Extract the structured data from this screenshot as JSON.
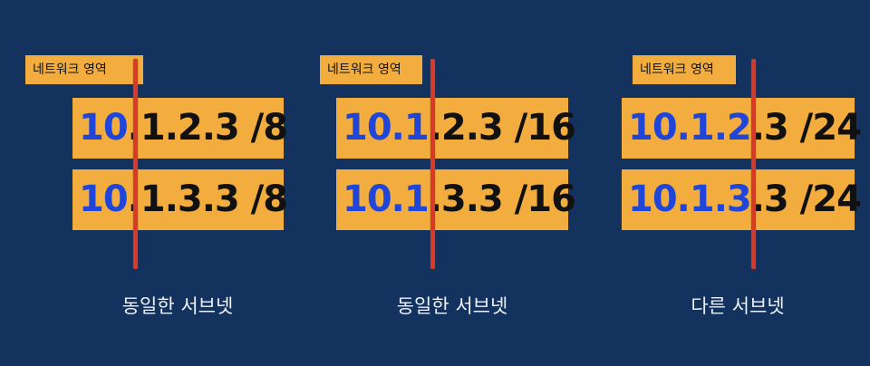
{
  "colors": {
    "background": "#13325e",
    "box": "#f3ad3e",
    "network_text": "#1f46d8",
    "host_text": "#111111",
    "divider": "#d83a2a",
    "caption": "#eef2f8"
  },
  "panels": [
    {
      "tag": "네트워크 영역",
      "rows": [
        {
          "net": "10",
          "host": ".1.2.3 /8"
        },
        {
          "net": "10",
          "host": ".1.3.3 /8"
        }
      ],
      "caption": "동일한 서브넷"
    },
    {
      "tag": "네트워크 영역",
      "rows": [
        {
          "net": "10.1",
          "host": ".2.3 /16"
        },
        {
          "net": "10.1",
          "host": ".3.3 /16"
        }
      ],
      "caption": "동일한 서브넷"
    },
    {
      "tag": "네트워크 영역",
      "rows": [
        {
          "net": "10.1.2",
          "host": ".3 /24"
        },
        {
          "net": "10.1.3",
          "host": ".3 /24"
        }
      ],
      "caption": "다른 서브넷"
    }
  ]
}
